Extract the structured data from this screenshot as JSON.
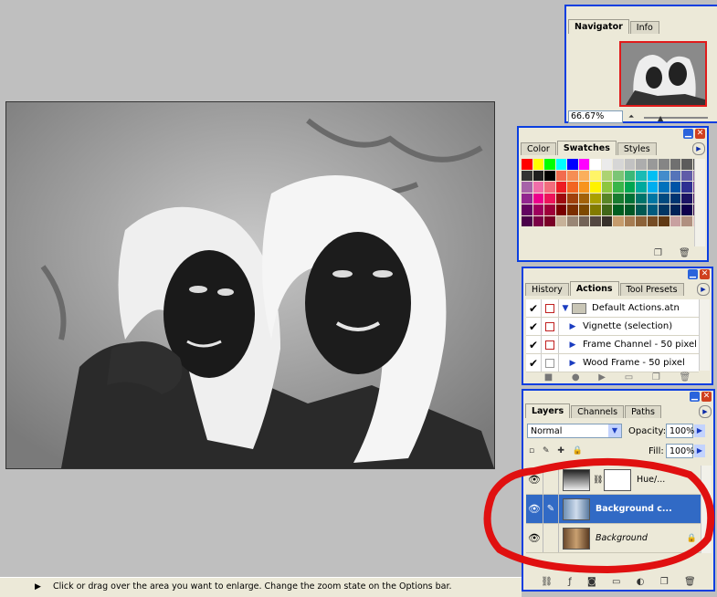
{
  "status_bar": {
    "message": "Click or drag over the area you want to enlarge. Change the zoom state on the Options bar."
  },
  "navigator": {
    "tabs": [
      {
        "label": "Navigator"
      },
      {
        "label": "Info"
      }
    ],
    "zoom": "66.67%"
  },
  "swatches_panel": {
    "tabs": [
      {
        "label": "Color"
      },
      {
        "label": "Swatches"
      },
      {
        "label": "Styles"
      }
    ]
  },
  "actions_panel": {
    "tabs": [
      {
        "label": "History"
      },
      {
        "label": "Actions"
      },
      {
        "label": "Tool Presets"
      }
    ],
    "items": [
      {
        "label": "Default Actions.atn",
        "checked": true
      },
      {
        "label": "Vignette (selection)",
        "checked": true
      },
      {
        "label": "Frame Channel - 50 pixel",
        "checked": true
      },
      {
        "label": "Wood Frame - 50 pixel",
        "checked": true
      }
    ]
  },
  "layers_panel": {
    "tabs": [
      {
        "label": "Layers"
      },
      {
        "label": "Channels"
      },
      {
        "label": "Paths"
      }
    ],
    "blend_mode": "Normal",
    "opacity_label": "Opacity:",
    "opacity_value": "100%",
    "fill_label": "Fill:",
    "fill_value": "100%",
    "layers": [
      {
        "name": "Hue/...",
        "selected": false
      },
      {
        "name": "Background c...",
        "selected": true
      },
      {
        "name": "Background",
        "selected": false
      }
    ]
  },
  "colors": {
    "selection": "#316ac5",
    "panel_border": "#0a3ee0",
    "annotation_red": "#e01010"
  },
  "swatch_colors": [
    "#ff0000",
    "#ffff00",
    "#00ff00",
    "#00ffff",
    "#0000ff",
    "#ff00ff",
    "#ffffff",
    "#ebebeb",
    "#d6d6d6",
    "#c2c2c2",
    "#adadad",
    "#999999",
    "#858585",
    "#707070",
    "#5c5c5c",
    "#474747",
    "#333333",
    "#1f1f1f",
    "#000000",
    "#f26c4f",
    "#f68e55",
    "#fbaf5c",
    "#fff467",
    "#acd372",
    "#7cc576",
    "#3bb878",
    "#1abbb4",
    "#00bff3",
    "#438ccb",
    "#5574b9",
    "#605ca8",
    "#855fa8",
    "#a763a8",
    "#f06ea9",
    "#f26d7d",
    "#ed1c24",
    "#f26522",
    "#f7941d",
    "#fff200",
    "#8dc63f",
    "#39b54a",
    "#00a651",
    "#00a99d",
    "#00aeef",
    "#0072bc",
    "#0054a6",
    "#2e3192",
    "#662d91",
    "#92278f",
    "#ec008c",
    "#ed145b",
    "#9e0b0f",
    "#a0410d",
    "#a3620a",
    "#aba000",
    "#598527",
    "#197b30",
    "#007236",
    "#00746b",
    "#0076a3",
    "#004a80",
    "#003471",
    "#1b1464",
    "#440e62",
    "#630460",
    "#9e005d",
    "#9e0039",
    "#790000",
    "#7b2e00",
    "#7d4900",
    "#827b00",
    "#406618",
    "#005e20",
    "#005826",
    "#005952",
    "#005b7f",
    "#003663",
    "#002157",
    "#0d004c",
    "#32004b",
    "#4b0049",
    "#7b0046",
    "#7a0026",
    "#c7b299",
    "#998675",
    "#736357",
    "#534741",
    "#37302a",
    "#c69c6d",
    "#a67c52",
    "#8c6239",
    "#754c24",
    "#603913",
    "#c8a0a0",
    "#b09080",
    "#e8c4c0"
  ]
}
